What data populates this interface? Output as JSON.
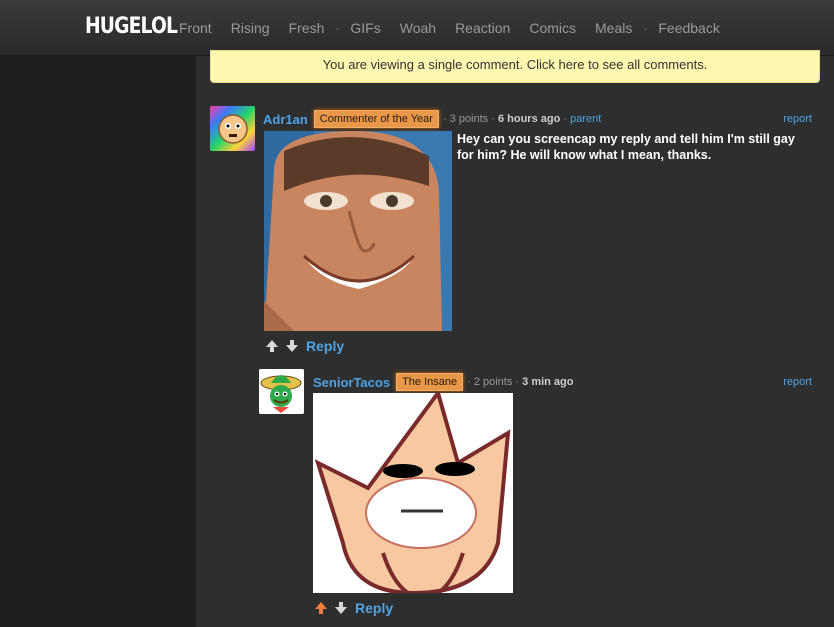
{
  "site": {
    "logo": "HUGELOL"
  },
  "nav": {
    "items": [
      "Front",
      "Rising",
      "Fresh",
      "GIFs",
      "Woah",
      "Reaction",
      "Comics",
      "Meals",
      "Feedback"
    ],
    "separator": "·"
  },
  "notice": "You are viewing a single comment. Click here to see all comments.",
  "comments": [
    {
      "username": "Adr1an",
      "badge": "Commenter of the Year",
      "points": "· 3 points ·",
      "time": "6 hours ago",
      "dot": "·",
      "parent": "parent",
      "report": "report",
      "text": "Hey can you screencap my reply and tell him I'm still gay for him? He will know what I mean, thanks.",
      "reply": "Reply"
    },
    {
      "username": "SeniorTacos",
      "badge": "The Insane",
      "points": "· 2 points ·",
      "time": "3 min ago",
      "report": "report",
      "reply": "Reply"
    }
  ],
  "colors": {
    "link": "#4da3e6",
    "badge": "#e89848",
    "notice_bg": "#fdf7b0",
    "upvote_active": "#f08040"
  }
}
